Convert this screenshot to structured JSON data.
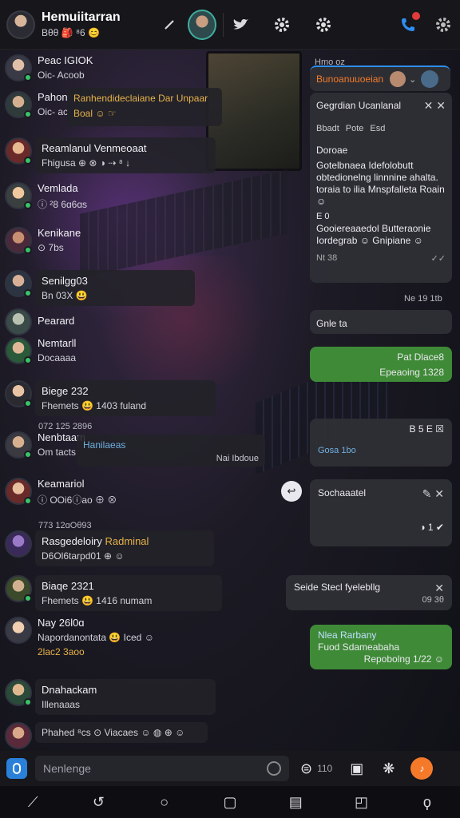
{
  "header": {
    "title": "Hemuiitarran",
    "subtitle": "Bθθ 🎒 ⁸6 😊",
    "icons": [
      "edit-icon",
      "bird-icon",
      "gear-icon",
      "gear-icon",
      "phone-icon",
      "settings-icon"
    ]
  },
  "chats": [
    {
      "name": "Peac IGIOK",
      "text": "Oic- Acoob",
      "preview": ""
    },
    {
      "name": "Pahon",
      "text": "Oic-  ac",
      "preview": "Ranhendideclaiane Dar Unpaar",
      "preview2": "Boal ☺ ☞"
    },
    {
      "name": "Reamlanul Venmeoaat",
      "text": "Fhigusa ⊕ ⊗ ◑ ⇢  ⁸ ↓"
    },
    {
      "name": "Vemlada",
      "text": "ⓘ ²8 6ɑ6ɑs"
    },
    {
      "name": "Kenikane",
      "text": "⊙ 7bs"
    },
    {
      "name": "Senilgg03",
      "text": "Bn 03X 😃"
    },
    {
      "name": "Pearard",
      "text": ""
    },
    {
      "name": "Nemtarll",
      "text": "Docaaaa"
    },
    {
      "name": "Biege 232",
      "text": "Fhemets 😃 1403 fuland"
    },
    {
      "name": "Nenbtaam",
      "text": "Om tacts",
      "preview": "Hanilaeas",
      "preview2": "Nai Ibdoue"
    },
    {
      "name": "Keamariol",
      "text": "ⓘ OOi6ⓘao ⊕ ⊗"
    },
    {
      "name": "Rasgedeloiry",
      "text": "D6Ol6tarpd01 ⊕ ☺",
      "meta": "773 12ɑOθ93",
      "extra": "Radminal"
    },
    {
      "name": "Biaqe 2321",
      "text": "Fhemets 😃 1416 numam",
      "meta": ""
    },
    {
      "name": "Nay 26l0ɑ",
      "text": "Napordanontata 😃 Iced ☺",
      "extra": "2lac2 3aoo"
    },
    {
      "name": "Dnahackam",
      "text": "Illenaaas"
    },
    {
      "name": "Phahed",
      "text": "⁸cs ⊙ Viacaes ☺ ◍ ⊕ ☺"
    }
  ],
  "right_pane": {
    "top_label": "Hmo oz",
    "card_title": "Bunoanuuoeian",
    "popup_title": "Gegrdian Ucanlanal",
    "popup_tags": [
      "Bbadt",
      "Pote",
      "Esd"
    ],
    "popup_heading": "Doroae",
    "popup_body": "Gotelbnaea Idefolobutt obtedionelng linnnine ahalta. toraia to ilia Mnspfalleta Roain ☺",
    "popup_body2_label": "E 0",
    "popup_body2": "Gooiereaaedol Butteraonie Iordegrab ☺ Gnipiane ☺",
    "popup_footer": "Nt 38",
    "time_1": "Ne 19 1tb",
    "card2_text": "Gnle ta",
    "green1_line1": "Pat Dlace8",
    "green1_line2": "Epeaoing 1328",
    "card3_line1": "B 5 E ☒",
    "card3_line2": "Gosa   1bo",
    "card4_title": "Sochaaatel",
    "card4_line2": "◑ 1 ✔",
    "card5_text": "Seide Stecl fyelebllg",
    "card5_time": "09 3θ",
    "green2_line1": "Nlea Rarbany",
    "green2_line2": "Fuod Sdameabaha",
    "green2_line3": "Repobolng 1/22 ☺"
  },
  "input": {
    "placeholder": "Nenlenge",
    "counter": "110"
  },
  "colors": {
    "accent_green": "#3f8a37",
    "accent_orange": "#f47a2a",
    "online": "#39c46b",
    "header_bg": "#16161b"
  }
}
